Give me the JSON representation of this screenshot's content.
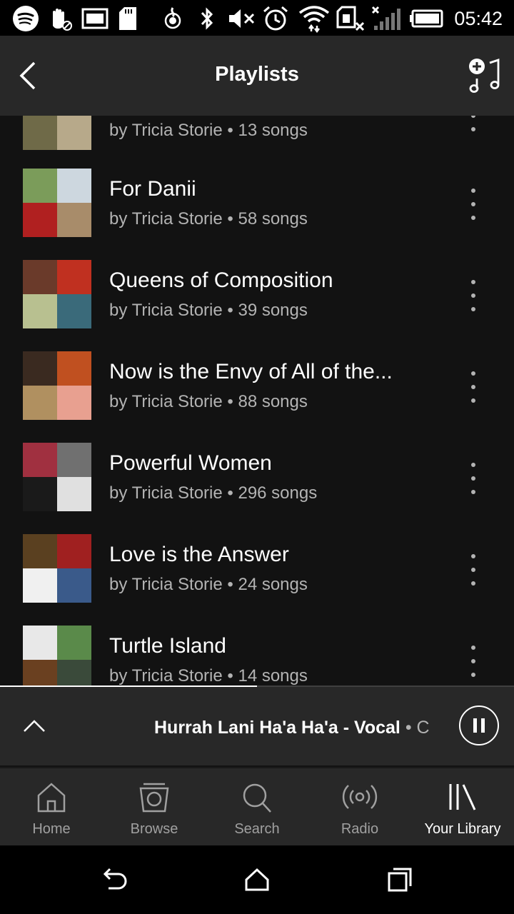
{
  "status_bar": {
    "time": "05:42",
    "icons": [
      "spotify-icon",
      "hand-icon",
      "image-icon",
      "sd-card-icon",
      "hotspot-icon",
      "bluetooth-icon",
      "mute-icon",
      "alarm-icon",
      "wifi-icon",
      "no-sim-icon",
      "signal-icon",
      "battery-icon"
    ]
  },
  "header": {
    "title": "Playlists",
    "back_icon": "back-chevron-icon",
    "add_icon": "add-song-icon"
  },
  "playlists": [
    {
      "name": "",
      "owner_line": "by Tricia Storie",
      "songs": "13 songs",
      "colors": [
        "#8a8a60",
        "#d8d0b8",
        "#6f6a48",
        "#b7a98a"
      ]
    },
    {
      "name": "For Danii",
      "owner_line": "by Tricia Storie",
      "songs": "58 songs",
      "colors": [
        "#7b9c5a",
        "#cdd7df",
        "#b02020",
        "#a88c6a"
      ]
    },
    {
      "name": "Queens of Composition",
      "owner_line": "by Tricia Storie",
      "songs": "39 songs",
      "colors": [
        "#6a3a2a",
        "#c03020",
        "#b8c090",
        "#3a6a7a"
      ]
    },
    {
      "name": "Now is the Envy of All of the...",
      "owner_line": "by Tricia Storie",
      "songs": "88 songs",
      "colors": [
        "#3a2a20",
        "#c05020",
        "#b09060",
        "#e8a090"
      ]
    },
    {
      "name": "Powerful Women",
      "owner_line": "by Tricia Storie",
      "songs": "296 songs",
      "colors": [
        "#a03040",
        "#707070",
        "#1a1a1a",
        "#e0e0e0"
      ]
    },
    {
      "name": "Love is the Answer",
      "owner_line": "by Tricia Storie",
      "songs": "24 songs",
      "colors": [
        "#5a4020",
        "#a02020",
        "#f0f0f0",
        "#3a5a8a"
      ]
    },
    {
      "name": "Turtle Island",
      "owner_line": "by Tricia Storie",
      "songs": "14 songs",
      "colors": [
        "#e8e8e8",
        "#5a8a4a",
        "#6a4020",
        "#3a4a3a"
      ]
    }
  ],
  "now_playing": {
    "title": "Hurrah Lani Ha'a Ha'a - Vocal",
    "separator": "•",
    "artist": "C",
    "progress": 0.5,
    "expand_icon": "chevron-up-icon",
    "pause_icon": "pause-icon"
  },
  "tabs": [
    {
      "label": "Home",
      "icon": "home-icon",
      "active": false
    },
    {
      "label": "Browse",
      "icon": "browse-icon",
      "active": false
    },
    {
      "label": "Search",
      "icon": "search-icon",
      "active": false
    },
    {
      "label": "Radio",
      "icon": "radio-icon",
      "active": false
    },
    {
      "label": "Your Library",
      "icon": "library-icon",
      "active": true
    }
  ],
  "system_nav": [
    "back-icon",
    "home-icon",
    "recents-icon"
  ],
  "colors": {
    "background": "#121212",
    "bar": "#282828",
    "subtext": "#b3b3b3",
    "accent": "#ffffff"
  }
}
